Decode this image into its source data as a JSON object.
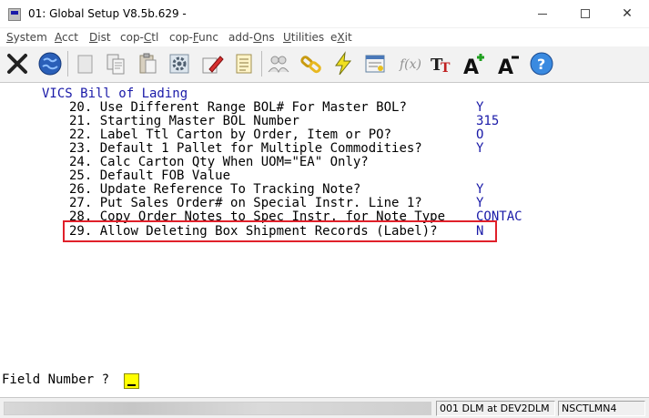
{
  "window": {
    "title": "01: Global Setup V8.5b.629 -"
  },
  "menu": [
    {
      "before": "",
      "u": "S",
      "after": "ystem"
    },
    {
      "before": "",
      "u": "A",
      "after": "cct"
    },
    {
      "before": "",
      "u": "D",
      "after": "ist"
    },
    {
      "before": "cop-",
      "u": "C",
      "after": "tl"
    },
    {
      "before": "cop-",
      "u": "F",
      "after": "unc"
    },
    {
      "before": "add-",
      "u": "O",
      "after": "ns"
    },
    {
      "before": "",
      "u": "U",
      "after": "tilities"
    },
    {
      "before": "e",
      "u": "X",
      "after": "it"
    }
  ],
  "toolbar": [
    {
      "icon": "close-x-icon"
    },
    {
      "icon": "globe-icon"
    },
    {
      "icon": "blank-page-icon"
    },
    {
      "icon": "copy-icon"
    },
    {
      "icon": "paste-icon"
    },
    {
      "icon": "settings-gear-icon"
    },
    {
      "icon": "edit-pencil-icon"
    },
    {
      "icon": "notepad-icon"
    },
    {
      "icon": "users-icon"
    },
    {
      "icon": "chain-link-icon"
    },
    {
      "icon": "lightning-icon"
    },
    {
      "icon": "form-window-icon"
    },
    {
      "icon": "function-icon"
    },
    {
      "icon": "font-tt-icon"
    },
    {
      "icon": "font-increase-icon"
    },
    {
      "icon": "font-decrease-icon"
    },
    {
      "icon": "help-icon"
    }
  ],
  "screen": {
    "header": "VICS Bill of Lading",
    "options": [
      {
        "num": "20.",
        "label": "Use Different Range BOL# For Master BOL?",
        "value": "Y"
      },
      {
        "num": "21.",
        "label": "Starting Master BOL Number",
        "value": "315"
      },
      {
        "num": "22.",
        "label": "Label Ttl Carton by Order, Item or PO?",
        "value": "O"
      },
      {
        "num": "23.",
        "label": "Default 1 Pallet for Multiple Commodities?",
        "value": "Y"
      },
      {
        "num": "24.",
        "label": "Calc Carton Qty When UOM=\"EA\" Only?",
        "value": ""
      },
      {
        "num": "25.",
        "label": "Default FOB Value",
        "value": ""
      },
      {
        "num": "26.",
        "label": "Update Reference To Tracking Note?",
        "value": "Y"
      },
      {
        "num": "27.",
        "label": "Put Sales Order# on Special Instr. Line 1?",
        "value": "Y"
      },
      {
        "num": "28.",
        "label": "Copy Order Notes to Spec Instr. for Note Type",
        "value": "CONTAC"
      },
      {
        "num": "29.",
        "label": "Allow Deleting Box Shipment Records (Label)?",
        "value": "N"
      }
    ],
    "prompt": "Field Number ?"
  },
  "status": {
    "connection": "001 DLM at DEV2DLM",
    "terminal": "NSCTLMN4"
  },
  "colors": {
    "value_blue": "#1a1aa8",
    "highlight_red": "#e0202a",
    "cursor_yellow": "#ffff00"
  }
}
